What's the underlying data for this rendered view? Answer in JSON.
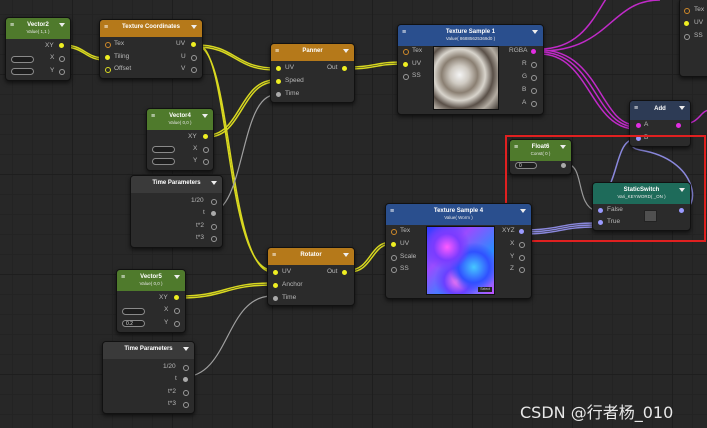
{
  "nodes": {
    "vector2_top": {
      "title": "Vector2",
      "subtitle": "Value( 1,1 )",
      "out": "XY",
      "x": "X",
      "y": "Y"
    },
    "texcoords": {
      "title": "Texture Coordinates",
      "in_tex": "Tex",
      "in_tiling": "Tiling",
      "in_offset": "Offset",
      "out_uv": "UV",
      "out_u": "U",
      "out_v": "V"
    },
    "panner": {
      "title": "Panner",
      "in_uv": "UV",
      "in_speed": "Speed",
      "in_time": "Time",
      "out": "Out"
    },
    "texsample1": {
      "title": "Texture Sample 1",
      "subtitle": "Value( 86885625369d0 )",
      "in_tex": "Tex",
      "in_uv": "UV",
      "in_ss": "SS",
      "out_rgba": "RGBA",
      "out_r": "R",
      "out_g": "G",
      "out_b": "B",
      "out_a": "A"
    },
    "vector4": {
      "title": "Vector4",
      "subtitle": "Value( 0,0 )",
      "out": "XY",
      "x": "X",
      "y": "Y"
    },
    "time1": {
      "title": "Time Parameters",
      "o1": "1/20",
      "o2": "t",
      "o3": "t*2",
      "o4": "t*3"
    },
    "float6": {
      "title": "Float6",
      "subtitle": "Const( 0 )",
      "value": "0"
    },
    "add": {
      "title": "Add",
      "in_a": "A",
      "in_b": "B"
    },
    "staticswitch": {
      "title": "StaticSwitch",
      "subtitle": "Vari_KEYWORD( _ON )",
      "in_false": "False",
      "in_true": "True"
    },
    "texsample4": {
      "title": "Texture Sample 4",
      "subtitle": "Value( Worm )",
      "in_tex": "Tex",
      "in_uv": "UV",
      "in_scale": "Scale",
      "in_ss": "SS",
      "out_xyz": "XYZ",
      "out_x": "X",
      "out_y": "Y",
      "out_z": "Z",
      "thumb_badge": "Select"
    },
    "rotator": {
      "title": "Rotator",
      "in_uv": "UV",
      "in_anchor": "Anchor",
      "in_time": "Time",
      "out": "Out"
    },
    "vector5": {
      "title": "Vector5",
      "subtitle": "Value( 0,0 )",
      "out": "XY",
      "x": "X",
      "y": "Y",
      "field_y": "0.2"
    },
    "time2": {
      "title": "Time Parameters",
      "o1": "1/20",
      "o2": "t",
      "o3": "t*2",
      "o4": "t*3"
    },
    "partial_right": {
      "tex": "Tex",
      "uv": "UV",
      "ss": "SS"
    }
  },
  "colors": {
    "yellow": "#eeee22",
    "magenta": "#e22ee2",
    "lavender": "#9a9aff",
    "highlight": "#e02020"
  },
  "watermark": "CSDN @行者杨_010"
}
